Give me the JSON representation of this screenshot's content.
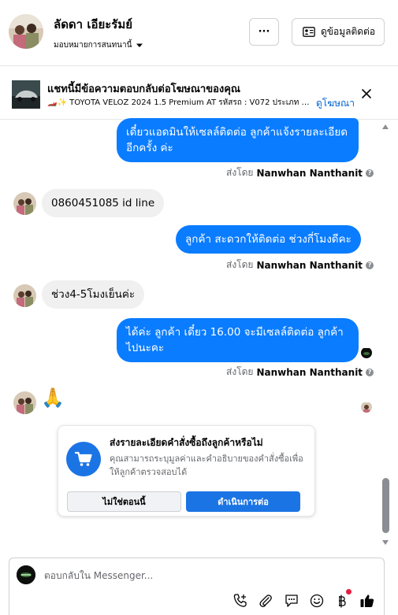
{
  "header": {
    "name": "ลัดดา เอียะรัมย์",
    "assign_label": "มอบหมายการสนทนานี้",
    "more_label": "···",
    "contact_button": "ดูข้อมูลติดต่อ"
  },
  "ad_banner": {
    "title": "แชทนี้มีข้อความตอบกลับต่อโฆษณาของคุณ",
    "description": "🏎️✨ TOYOTA VELOZ 2024 1.5 Premium AT รหัสรถ : V072 ประเภท : S...",
    "link": "ดูโฆษณา"
  },
  "messages": [
    {
      "direction": "out",
      "text": "เดี๋ยวแอดมินให้เซลล์ติดต่อ ลูกค้าแจ้งรายละเอียดอีกครั้ง ค่ะ"
    },
    {
      "direction": "in",
      "text": "0860451085 id line"
    },
    {
      "direction": "out",
      "text": "ลูกค้า สะดวกให้ติดต่อ ช่วงกี่โมงดีคะ"
    },
    {
      "direction": "in",
      "text": "ช่วง4-5โมงเย็นค่ะ"
    },
    {
      "direction": "out",
      "text": "ได้ค่ะ  ลูกค้า เดี๋ยว 16.00 จะมีเซลล์ติดต่อ ลูกค้าไปนะคะ"
    },
    {
      "direction": "in",
      "text": "🙏"
    }
  ],
  "sent_by": {
    "prefix": "ส่งโดย",
    "name": "Nanwhan Nanthanit",
    "info_icon": "?"
  },
  "order_card": {
    "title": "ส่งรายละเอียดคำสั่งซื้อถึงลูกค้าหรือไม่",
    "description": "คุณสามารถระบุมูลค่าและคำอธิบายของคำสั่งซื้อเพื่อให้ลูกค้าตรวจสอบได้",
    "secondary_button": "ไม่ใช่ตอนนี้",
    "primary_button": "ดำเนินการต่อ"
  },
  "composer": {
    "placeholder": "ตอบกลับใน Messenger..."
  },
  "colors": {
    "accent": "#0a7cff",
    "primary_button": "#1b74e4",
    "link": "#0064d1"
  },
  "icons": [
    "chevron-down-icon",
    "contact-card-icon",
    "close-icon",
    "cart-icon",
    "phone-add-icon",
    "paperclip-icon",
    "saved-reply-icon",
    "emoji-icon",
    "baht-icon",
    "thumbs-up-icon"
  ]
}
